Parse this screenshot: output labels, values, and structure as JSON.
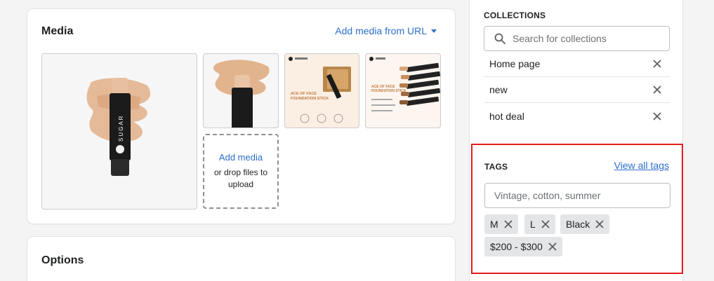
{
  "media": {
    "title": "Media",
    "add_from_url": "Add media from URL",
    "drop_add": "Add media",
    "drop_hint": "or drop files to upload",
    "thumbs": [
      "product-stick-main",
      "product-stick-swatch",
      "ace-of-face-foundation-stick-box",
      "ace-of-face-foundation-stick-shades"
    ],
    "thumb3_heading": "ACE OF FACE\nFOUNDATION STICK",
    "thumb4_heading": "ACE OF FACE\nFOUNDATION STICK"
  },
  "options": {
    "title": "Options"
  },
  "collections": {
    "heading": "COLLECTIONS",
    "search_placeholder": "Search for collections",
    "items": [
      {
        "label": "Home page"
      },
      {
        "label": "new"
      },
      {
        "label": "hot deal"
      }
    ]
  },
  "tags": {
    "heading": "TAGS",
    "view_all": "View all tags",
    "input_placeholder": "Vintage, cotton, summer",
    "items": [
      "M",
      "L",
      "Black",
      "$200 - $300"
    ]
  },
  "colors": {
    "link": "#2c6ecb",
    "highlight_border": "#e11d1d",
    "tag_bg": "#e4e5e7"
  }
}
